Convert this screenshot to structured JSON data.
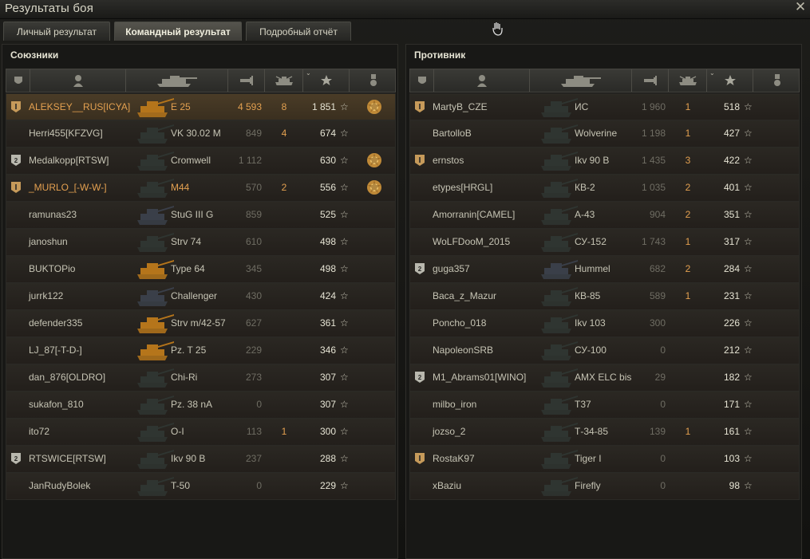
{
  "window": {
    "title": "Результаты боя"
  },
  "tabs": [
    {
      "label": "Личный результат",
      "active": false
    },
    {
      "label": "Командный результат",
      "active": true
    },
    {
      "label": "Подробный отчёт",
      "active": false
    }
  ],
  "allies": {
    "title": "Союзники",
    "rows": [
      {
        "rank": "1",
        "name": "ALEKSEY__RUS[ICYA]",
        "vehicle": "E 25",
        "damage": "4 593",
        "kills": "8",
        "xp": "1 851",
        "medal": "true",
        "highlight": "true",
        "tank_color": "#b5751b"
      },
      {
        "rank": "",
        "name": "Herri455[KFZVG]",
        "vehicle": "VK 30.02 M",
        "damage": "849",
        "kills": "4",
        "xp": "674",
        "medal": "",
        "tank_color": "#2f3531"
      },
      {
        "rank": "2",
        "name": "Medalkopp[RTSW]",
        "vehicle": "Cromwell",
        "damage": "1 112",
        "kills": "",
        "xp": "630",
        "medal": "true",
        "tank_color": "#2f3531"
      },
      {
        "rank": "1",
        "name": "_MURLO_[-W-W-]",
        "vehicle": "M44",
        "damage": "570",
        "kills": "2",
        "xp": "556",
        "medal": "true",
        "orange": "true",
        "tank_color": "#2f3531"
      },
      {
        "rank": "",
        "name": "ramunas23",
        "vehicle": "StuG III G",
        "damage": "859",
        "kills": "",
        "xp": "525",
        "medal": "",
        "tank_color": "#3a3f49"
      },
      {
        "rank": "",
        "name": "janoshun",
        "vehicle": "Strv 74",
        "damage": "610",
        "kills": "",
        "xp": "498",
        "medal": "",
        "tank_color": "#2f3531"
      },
      {
        "rank": "",
        "name": "BUKTOPio",
        "vehicle": "Type 64",
        "damage": "345",
        "kills": "",
        "xp": "498",
        "medal": "",
        "tank_color": "#b5751b"
      },
      {
        "rank": "",
        "name": "jurrk122",
        "vehicle": "Challenger",
        "damage": "430",
        "kills": "",
        "xp": "424",
        "medal": "",
        "tank_color": "#3a3f49"
      },
      {
        "rank": "",
        "name": "defender335",
        "vehicle": "Strv m/42-57",
        "damage": "627",
        "kills": "",
        "xp": "361",
        "medal": "",
        "tank_color": "#b5751b"
      },
      {
        "rank": "",
        "name": "LJ_87[-T-D-]",
        "vehicle": "Pz. T 25",
        "damage": "229",
        "kills": "",
        "xp": "346",
        "medal": "",
        "tank_color": "#b5751b"
      },
      {
        "rank": "",
        "name": "dan_876[OLDRO]",
        "vehicle": "Chi-Ri",
        "damage": "273",
        "kills": "",
        "xp": "307",
        "medal": "",
        "tank_color": "#2f3531"
      },
      {
        "rank": "",
        "name": "sukafon_810",
        "vehicle": "Pz. 38 nA",
        "damage": "0",
        "kills": "",
        "xp": "307",
        "medal": "",
        "tank_color": "#2f3531"
      },
      {
        "rank": "",
        "name": "ito72",
        "vehicle": "O-I",
        "damage": "113",
        "kills": "1",
        "xp": "300",
        "medal": "",
        "tank_color": "#2f3531"
      },
      {
        "rank": "2",
        "name": "RTSWICE[RTSW]",
        "vehicle": "Ikv 90 B",
        "damage": "237",
        "kills": "",
        "xp": "288",
        "medal": "",
        "tank_color": "#2f3531"
      },
      {
        "rank": "",
        "name": "JanRudyBolek",
        "vehicle": "T-50",
        "damage": "0",
        "kills": "",
        "xp": "229",
        "medal": "",
        "tank_color": "#2f3531"
      }
    ]
  },
  "enemies": {
    "title": "Противник",
    "rows": [
      {
        "rank": "1",
        "name": "MartyB_CZE",
        "vehicle": "ИС",
        "damage": "1 960",
        "kills": "1",
        "xp": "518",
        "tank_color": "#2f3531"
      },
      {
        "rank": "",
        "name": "BartolloB",
        "vehicle": "Wolverine",
        "damage": "1 198",
        "kills": "1",
        "xp": "427",
        "tank_color": "#2f3531"
      },
      {
        "rank": "1",
        "name": "ernstos",
        "vehicle": "Ikv 90 B",
        "damage": "1 435",
        "kills": "3",
        "xp": "422",
        "tank_color": "#2f3531"
      },
      {
        "rank": "",
        "name": "etypes[HRGL]",
        "vehicle": "КВ-2",
        "damage": "1 035",
        "kills": "2",
        "xp": "401",
        "tank_color": "#2f3531"
      },
      {
        "rank": "",
        "name": "Amorranin[CAMEL]",
        "vehicle": "А-43",
        "damage": "904",
        "kills": "2",
        "xp": "351",
        "tank_color": "#2f3531"
      },
      {
        "rank": "",
        "name": "WoLFDooM_2015",
        "vehicle": "СУ-152",
        "damage": "1 743",
        "kills": "1",
        "xp": "317",
        "tank_color": "#2f3531"
      },
      {
        "rank": "2",
        "name": "guga357",
        "vehicle": "Hummel",
        "damage": "682",
        "kills": "2",
        "xp": "284",
        "tank_color": "#3a3f49"
      },
      {
        "rank": "",
        "name": "Baca_z_Mazur",
        "vehicle": "КВ-85",
        "damage": "589",
        "kills": "1",
        "xp": "231",
        "tank_color": "#2f3531"
      },
      {
        "rank": "",
        "name": "Poncho_018",
        "vehicle": "Ikv 103",
        "damage": "300",
        "kills": "",
        "xp": "226",
        "tank_color": "#2f3531"
      },
      {
        "rank": "",
        "name": "NapoleonSRB",
        "vehicle": "СУ-100",
        "damage": "0",
        "kills": "",
        "xp": "212",
        "tank_color": "#2f3531"
      },
      {
        "rank": "2",
        "name": "M1_Abrams01[WINO]",
        "vehicle": "AMX ELC bis",
        "damage": "29",
        "kills": "",
        "xp": "182",
        "tank_color": "#2f3531"
      },
      {
        "rank": "",
        "name": "milbo_iron",
        "vehicle": "T37",
        "damage": "0",
        "kills": "",
        "xp": "171",
        "tank_color": "#2f3531"
      },
      {
        "rank": "",
        "name": "jozso_2",
        "vehicle": "Т-34-85",
        "damage": "139",
        "kills": "1",
        "xp": "161",
        "tank_color": "#2f3531"
      },
      {
        "rank": "1",
        "name": "RostaK97",
        "vehicle": "Tiger I",
        "damage": "0",
        "kills": "",
        "xp": "103",
        "tank_color": "#2f3531"
      },
      {
        "rank": "",
        "name": "xBaziu",
        "vehicle": "Firefly",
        "damage": "0",
        "kills": "",
        "xp": "98",
        "tank_color": "#2f3531"
      }
    ]
  },
  "icons": {
    "close": "close-icon",
    "header": [
      "rank-icon",
      "player-icon",
      "tank-icon",
      "damage-icon",
      "kills-icon",
      "xp-star-icon",
      "medal-icon"
    ]
  },
  "symbols": {
    "xp_star": "☆",
    "close": "✕",
    "sort_arrow": "⌄"
  }
}
